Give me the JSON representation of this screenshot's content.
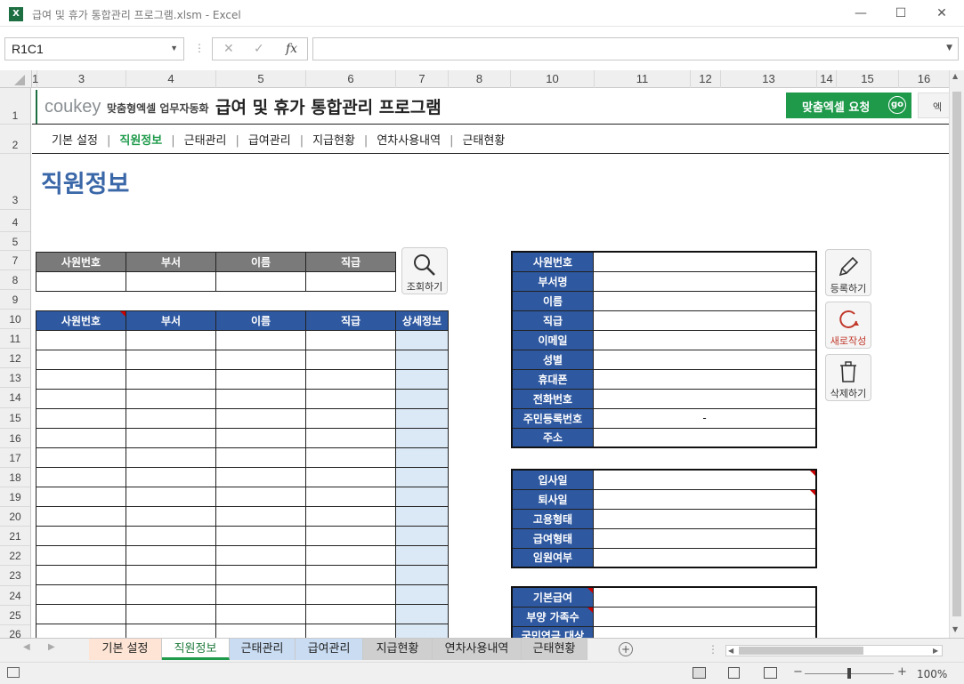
{
  "window": {
    "title": "급여 및 휴가 통합관리 프로그램.xlsm - Excel",
    "app_icon": "X"
  },
  "formula_bar": {
    "name_box": "R1C1",
    "fx": "fx"
  },
  "column_headers": [
    "1",
    "3",
    "4",
    "5",
    "6",
    "7",
    "8",
    "10",
    "11",
    "12",
    "13",
    "14",
    "15",
    "16"
  ],
  "row_headers": [
    "1",
    "2",
    "3",
    "4",
    "5",
    "7",
    "8",
    "9",
    "10",
    "11",
    "12",
    "13",
    "14",
    "15",
    "16",
    "17",
    "18",
    "19",
    "20",
    "21",
    "22",
    "23",
    "24",
    "25",
    "26"
  ],
  "header": {
    "logo": "coukey",
    "logo_sub": "맞춤형엑셀 업무자동화",
    "app_title": "급여 및 휴가 통합관리 프로그램",
    "request_button": "맞춤엑셀 요청",
    "request_badge": "go",
    "extra_button": "엑"
  },
  "nav": [
    "기본 설정",
    "직원정보",
    "근태관리",
    "급여관리",
    "지급현황",
    "연차사용내역",
    "근태현황"
  ],
  "nav_separator": "|",
  "page_title": "직원정보",
  "search_table": {
    "headers": [
      "사원번호",
      "부서",
      "이름",
      "직급"
    ]
  },
  "search_button": "조회하기",
  "list_table": {
    "headers": [
      "사원번호",
      "부서",
      "이름",
      "직급",
      "상세정보"
    ]
  },
  "detail_labels": [
    "사원번호",
    "부서명",
    "이름",
    "직급",
    "이메일",
    "성별",
    "휴대폰",
    "전화번호",
    "주민등록번호",
    "주소"
  ],
  "detail_values": {
    "resident_no": "-"
  },
  "employment_labels": [
    "입사일",
    "퇴사일",
    "고용형태",
    "급여형태",
    "임원여부"
  ],
  "salary_labels": [
    "기본급여",
    "부양 가족수",
    "국민연금 대상"
  ],
  "buttons": {
    "register": "등록하기",
    "new": "새로작성",
    "delete": "삭제하기"
  },
  "sheet_tabs": [
    "기본 설정",
    "직원정보",
    "근태관리",
    "급여관리",
    "지급현황",
    "연차사용내역",
    "근태현황"
  ],
  "status": {
    "zoom": "100%"
  }
}
